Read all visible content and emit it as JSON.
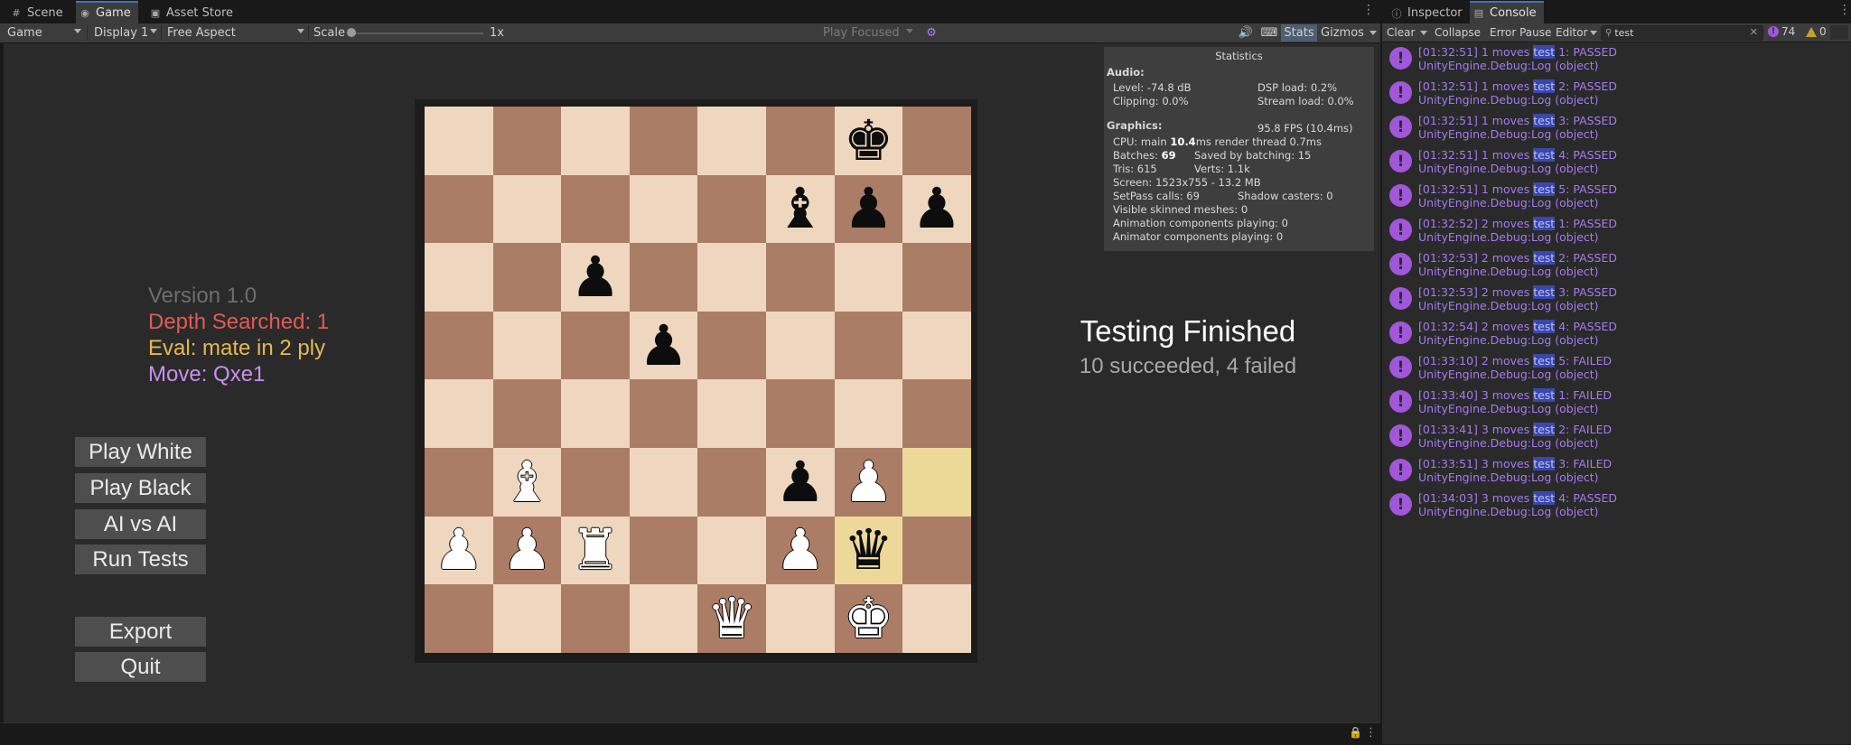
{
  "left_tabs": [
    {
      "label": "Scene",
      "icon": "grid-icon"
    },
    {
      "label": "Game",
      "icon": "gamepad-icon"
    },
    {
      "label": "Asset Store",
      "icon": "bag-icon"
    }
  ],
  "right_tabs": [
    {
      "label": "Inspector",
      "icon": "info-icon"
    },
    {
      "label": "Console",
      "icon": "console-icon"
    }
  ],
  "game_toolbar": {
    "view_select": "Game",
    "display_select": "Display 1",
    "aspect_select": "Free Aspect",
    "scale_label": "Scale",
    "scale_value": "1x",
    "play_mode": "Play Focused",
    "stats_label": "Stats",
    "gizmos_label": "Gizmos"
  },
  "info": {
    "version": "Version 1.0",
    "depth": "Depth Searched: 1",
    "eval": "Eval: mate in 2 ply",
    "move": "Move: Qxe1",
    "colors": {
      "version": "#6d6d6d",
      "depth": "#e05b57",
      "eval": "#e6b94f",
      "move": "#c98ff0"
    }
  },
  "menu_buttons": [
    "Play White",
    "Play Black",
    "AI vs AI",
    "Run Tests",
    "Export",
    "Quit"
  ],
  "board": {
    "rows": [
      [
        "",
        "",
        "",
        "",
        "",
        "",
        "bk",
        ""
      ],
      [
        "",
        "",
        "",
        "",
        "",
        "bb",
        "bp",
        "bp"
      ],
      [
        "",
        "",
        "bp",
        "",
        "",
        "",
        "",
        ""
      ],
      [
        "",
        "",
        "",
        "bp",
        "",
        "",
        "",
        ""
      ],
      [
        "",
        "",
        "",
        "",
        "",
        "",
        "",
        ""
      ],
      [
        "",
        "wb",
        "",
        "",
        "",
        "bp",
        "wp",
        ""
      ],
      [
        "wp",
        "wp",
        "wr",
        "",
        "",
        "wp",
        "bq",
        ""
      ],
      [
        "",
        "",
        "",
        "",
        "wq",
        "",
        "wk",
        ""
      ]
    ],
    "highlights": [
      [
        5,
        7
      ],
      [
        6,
        6
      ]
    ]
  },
  "result": {
    "title": "Testing Finished",
    "summary": "10 succeeded, 4 failed"
  },
  "stats": {
    "title": "Statistics",
    "audio_label": "Audio:",
    "level": "Level: -74.8 dB",
    "clipping": "Clipping: 0.0%",
    "dsp": "DSP load: 0.2%",
    "stream": "Stream load: 0.0%",
    "graphics_label": "Graphics:",
    "fps": "95.8 FPS (10.4ms)",
    "cpu_prefix": "CPU: main ",
    "cpu_main": "10.4",
    "cpu_suffix": "ms  render thread 0.7ms",
    "batches_prefix": "Batches: ",
    "batches": "69",
    "saved": "Saved by batching: 15",
    "tris": "Tris: 615",
    "verts": "Verts: 1.1k",
    "screen": "Screen: 1523x755 - 13.2 MB",
    "setpass": "SetPass calls: 69",
    "shadow": "Shadow casters: 0",
    "skinned": "Visible skinned meshes: 0",
    "anim": "Animation components playing: 0",
    "animator": "Animator components playing: 0"
  },
  "console_toolbar": {
    "clear": "Clear",
    "collapse": "Collapse",
    "error_pause": "Error Pause",
    "editor": "Editor",
    "search_value": "test",
    "warn_count": "74",
    "err_count": "0"
  },
  "logs": [
    {
      "pre": "[01:32:51] 1 moves ",
      "hl": "test",
      "post": " 1: PASSED",
      "src": "UnityEngine.Debug:Log (object)"
    },
    {
      "pre": "[01:32:51] 1 moves ",
      "hl": "test",
      "post": " 2: PASSED",
      "src": "UnityEngine.Debug:Log (object)"
    },
    {
      "pre": "[01:32:51] 1 moves ",
      "hl": "test",
      "post": " 3: PASSED",
      "src": "UnityEngine.Debug:Log (object)"
    },
    {
      "pre": "[01:32:51] 1 moves ",
      "hl": "test",
      "post": " 4: PASSED",
      "src": "UnityEngine.Debug:Log (object)"
    },
    {
      "pre": "[01:32:51] 1 moves ",
      "hl": "test",
      "post": " 5: PASSED",
      "src": "UnityEngine.Debug:Log (object)"
    },
    {
      "pre": "[01:32:52] 2 moves ",
      "hl": "test",
      "post": " 1: PASSED",
      "src": "UnityEngine.Debug:Log (object)"
    },
    {
      "pre": "[01:32:53] 2 moves ",
      "hl": "test",
      "post": " 2: PASSED",
      "src": "UnityEngine.Debug:Log (object)"
    },
    {
      "pre": "[01:32:53] 2 moves ",
      "hl": "test",
      "post": " 3: PASSED",
      "src": "UnityEngine.Debug:Log (object)"
    },
    {
      "pre": "[01:32:54] 2 moves ",
      "hl": "test",
      "post": " 4: PASSED",
      "src": "UnityEngine.Debug:Log (object)"
    },
    {
      "pre": "[01:33:10] 2 moves ",
      "hl": "test",
      "post": " 5: FAILED",
      "src": "UnityEngine.Debug:Log (object)"
    },
    {
      "pre": "[01:33:40] 3 moves ",
      "hl": "test",
      "post": " 1: FAILED",
      "src": "UnityEngine.Debug:Log (object)"
    },
    {
      "pre": "[01:33:41] 3 moves ",
      "hl": "test",
      "post": " 2: FAILED",
      "src": "UnityEngine.Debug:Log (object)"
    },
    {
      "pre": "[01:33:51] 3 moves ",
      "hl": "test",
      "post": " 3: FAILED",
      "src": "UnityEngine.Debug:Log (object)"
    },
    {
      "pre": "[01:34:03] 3 moves ",
      "hl": "test",
      "post": " 4: PASSED",
      "src": "UnityEngine.Debug:Log (object)"
    }
  ]
}
